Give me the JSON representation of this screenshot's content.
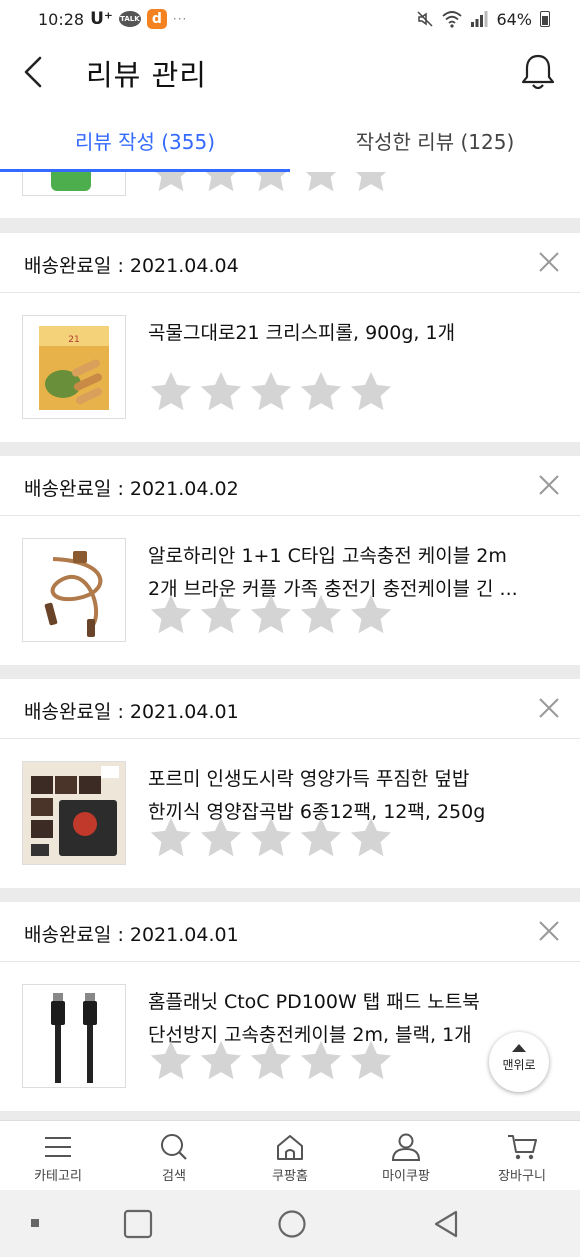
{
  "status_bar": {
    "time": "10:28",
    "carrier": "U⁺",
    "talk_label": "TALK",
    "app_badge": "d",
    "more": "···",
    "battery": "64%"
  },
  "header": {
    "title": "리뷰 관리"
  },
  "tabs": [
    {
      "label": "리뷰 작성 (355)",
      "active": true
    },
    {
      "label": "작성한 리뷰 (125)",
      "active": false
    }
  ],
  "orders": [
    {
      "delivery_date": "배송완료일 : 2021.04.04",
      "product_lines": [
        "곡물그대로21 크리스피롤, 900g, 1개"
      ],
      "rating": 0
    },
    {
      "delivery_date": "배송완료일 : 2021.04.02",
      "product_lines": [
        "알로하리안 1+1 C타입 고속충전 케이블 2m",
        "2개 브라운 커플 가족 충전기 충전케이블 긴 ..."
      ],
      "rating": 0
    },
    {
      "delivery_date": "배송완료일 : 2021.04.01",
      "product_lines": [
        "포르미 인생도시락 영양가득 푸짐한 덮밥",
        "한끼식 영양잡곡밥 6종12팩, 12팩, 250g"
      ],
      "rating": 0
    },
    {
      "delivery_date": "배송완료일 : 2021.04.01",
      "product_lines": [
        "홈플래닛 CtoC PD100W 탭 패드 노트북",
        "단선방지 고속충전케이블 2m, 블랙, 1개"
      ],
      "rating": 0
    }
  ],
  "scroll_top_button": {
    "label": "맨위로"
  },
  "bottom_nav": [
    {
      "label": "카테고리",
      "icon": "menu-icon"
    },
    {
      "label": "검색",
      "icon": "search-icon"
    },
    {
      "label": "쿠팡홈",
      "icon": "home-icon"
    },
    {
      "label": "마이쿠팡",
      "icon": "person-icon"
    },
    {
      "label": "장바구니",
      "icon": "cart-icon"
    }
  ],
  "colors": {
    "accent": "#346aff",
    "star_empty": "#d4d4d4",
    "background": "#ebebeb"
  }
}
